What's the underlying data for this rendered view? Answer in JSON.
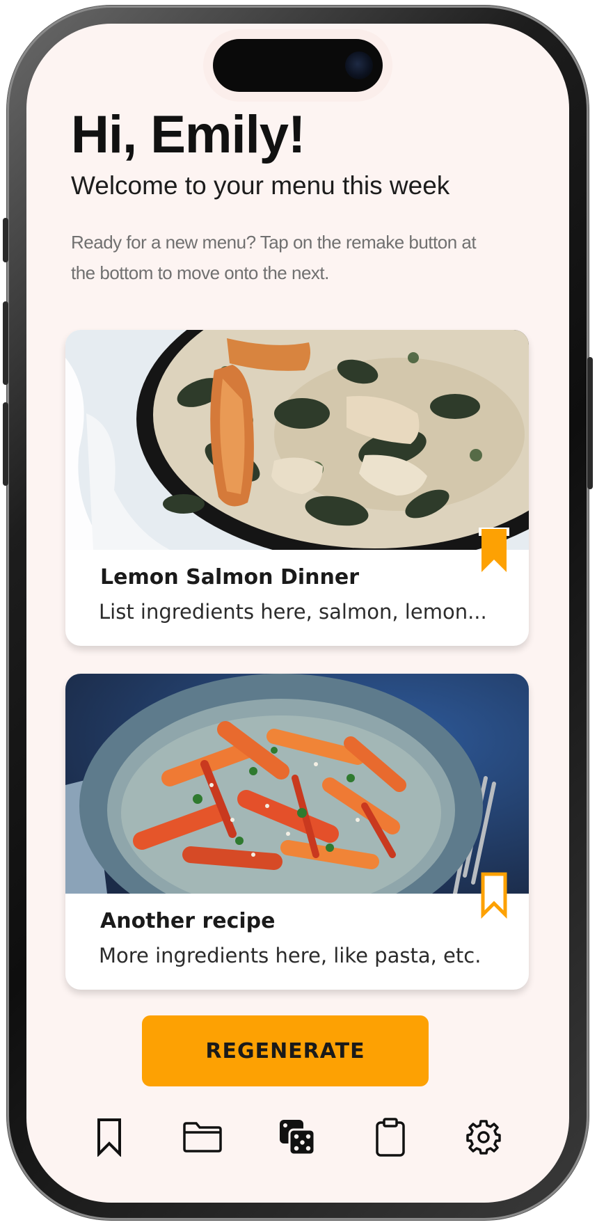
{
  "header": {
    "greeting": "Hi, Emily!",
    "subtitle": "Welcome to your menu this week",
    "hint": "Ready for a new menu? Tap on the remake button at the bottom to move onto the next."
  },
  "recipes": [
    {
      "title": "Lemon Salmon Dinner",
      "description": "List ingredients here, salmon, lemon...",
      "bookmarked": true,
      "image_icon": "salmon-skillet-photo"
    },
    {
      "title": "Another recipe",
      "description": "More ingredients here, like pasta, etc.",
      "bookmarked": false,
      "image_icon": "penne-bowl-photo"
    }
  ],
  "actions": {
    "regenerate_label": "REGENERATE"
  },
  "tabbar": {
    "items": [
      {
        "icon": "bookmark-icon"
      },
      {
        "icon": "folder-icon"
      },
      {
        "icon": "dice-icon",
        "active": true
      },
      {
        "icon": "clipboard-icon"
      },
      {
        "icon": "gear-icon"
      }
    ]
  },
  "colors": {
    "accent": "#fda103",
    "background": "#fdf4f2",
    "card": "#ffffff",
    "text": "#111111"
  }
}
